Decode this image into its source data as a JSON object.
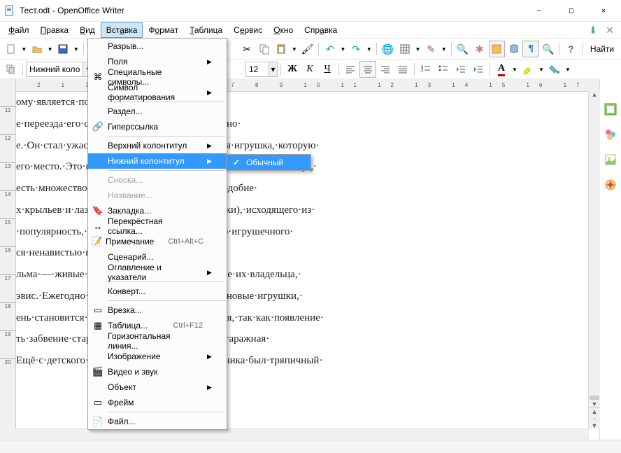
{
  "title": "Тест.odt - OpenOffice Writer",
  "window_controls": {
    "min": "—",
    "max": "□",
    "close": "✕"
  },
  "menubar": [
    "Файл",
    "Правка",
    "Вид",
    "Вставка",
    "Формат",
    "Таблица",
    "Сервис",
    "Окно",
    "Справка"
  ],
  "menubar_selected": "Вставка",
  "insert_menu": [
    {
      "icon": "",
      "label": "Разрыв...",
      "sub": false
    },
    {
      "icon": "",
      "label": "Поля",
      "sub": true
    },
    {
      "icon": "⌘",
      "label": "Специальные символы...",
      "sub": false
    },
    {
      "icon": "",
      "label": "Символ форматирования",
      "sub": true
    },
    {
      "sep": true
    },
    {
      "icon": "",
      "label": "Раздел...",
      "sub": false
    },
    {
      "icon": "🔗",
      "label": "Гиперссылка",
      "sub": false
    },
    {
      "sep": true
    },
    {
      "icon": "",
      "label": "Верхний колонтитул",
      "sub": true
    },
    {
      "icon": "",
      "label": "Нижний колонтитул",
      "sub": true,
      "highlight": true
    },
    {
      "sep": true
    },
    {
      "icon": "",
      "label": "Сноска...",
      "sub": false,
      "disabled": true
    },
    {
      "icon": "",
      "label": "Название...",
      "sub": false,
      "disabled": true
    },
    {
      "icon": "🔖",
      "label": "Закладка...",
      "sub": false
    },
    {
      "icon": "↔",
      "label": "Перекрёстная ссылка...",
      "sub": false
    },
    {
      "icon": "📝",
      "label": "Примечание",
      "shortcut": "Ctrl+Alt+C",
      "sub": false
    },
    {
      "icon": "",
      "label": "Сценарий...",
      "sub": false
    },
    {
      "icon": "",
      "label": "Оглавление и указатели",
      "sub": true
    },
    {
      "sep": true
    },
    {
      "icon": "",
      "label": "Конверт...",
      "sub": false
    },
    {
      "sep": true
    },
    {
      "icon": "▭",
      "label": "Врезка...",
      "sub": false
    },
    {
      "icon": "▦",
      "label": "Таблица...",
      "shortcut": "Ctrl+F12",
      "sub": false
    },
    {
      "icon": "",
      "label": "Горизонтальная линия...",
      "sub": false
    },
    {
      "icon": "",
      "label": "Изображение",
      "sub": true
    },
    {
      "icon": "🎬",
      "label": "Видео и звук",
      "sub": false
    },
    {
      "icon": "",
      "label": "Объект",
      "sub": true
    },
    {
      "icon": "▭",
      "label": "Фрейм",
      "sub": false
    },
    {
      "sep": true
    },
    {
      "icon": "📄",
      "label": "Файл...",
      "sub": false
    }
  ],
  "submenu": {
    "checked": true,
    "label": "Обычный"
  },
  "toolbar": {
    "style_combo": "Нижний коло",
    "font_combo": "",
    "size_combo": "12",
    "find_label": "Найти"
  },
  "ruler_h": "2   1     1   2   3   4   5   6   7   8   9  10  11  12  13  14  15  16  17  ",
  "doc_lines": [
    "ому·является·постоянной·угрозой·для·них.¶",
    "е·переезда·его·семьи·в·новый·дом,·было·решено·",
    "е.·Он·стал·ужасным·днём·в·жизни·Вуди:·новая·игрушка,·которую·",
    "его·место.·Это·новая,·суперпопулярная·игрушка·—·Базз·Лайтер·,·",
    "есть·множество·разнообразных·функций,·наподобие·",
    "х·крыльев·и·лазерного·луча·(лазерной·лампочки),·исходящего·из·",
    "·популярность,·не·только·у·Энди,·но·и·у·всего·игрушечного·",
    "ся·ненавистью·к·новой·игрушке.¶",
    "льма·—·живые·игрушки,·обитающие·в·комнате·их·владельца,·",
    "эвис.·Ежегодно·ко·дню·рождения·Энди·дарят·новые·игрушки,·",
    "ень·становится·источником·большого·волнения,·так·как·появление·",
    "ть·забвение·старой,·после·чего·их·ждет·либо·гаражная·",
    "Ещё·с·детского·сада·любимой·игрушкой·мальчика·был·тряпичный·"
  ],
  "vruler_ticks": [
    "11",
    "12",
    "13",
    "14",
    "15",
    "16",
    "17",
    "18",
    "19",
    "20"
  ]
}
